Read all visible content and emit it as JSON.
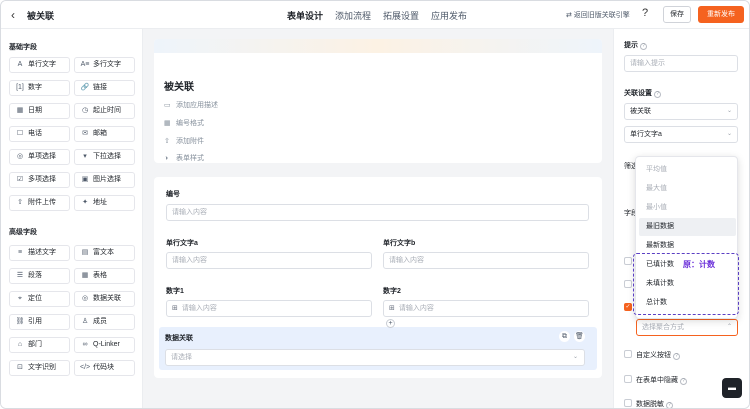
{
  "header": {
    "back_icon": "chevron-left-icon",
    "title": "被关联",
    "tabs": [
      "表单设计",
      "添加流程",
      "拓展设置",
      "应用发布"
    ],
    "active_tab": "表单设计",
    "swap_link": "⇄ 返回旧版关联引擎",
    "help_icon": "question-icon",
    "save_label": "保存",
    "publish_label": "重新发布",
    "accent_color": "#f5621f"
  },
  "left": {
    "basic_title": "基础字段",
    "basic_fields": [
      {
        "icon": "A",
        "label": "单行文字"
      },
      {
        "icon": "A≡",
        "label": "多行文字"
      },
      {
        "icon": "[1]",
        "label": "数字"
      },
      {
        "icon": "🔗",
        "label": "链接"
      },
      {
        "icon": "▦",
        "label": "日期"
      },
      {
        "icon": "◷",
        "label": "起止时间"
      },
      {
        "icon": "☐",
        "label": "电话"
      },
      {
        "icon": "✉",
        "label": "邮箱"
      },
      {
        "icon": "◎",
        "label": "单项选择"
      },
      {
        "icon": "▾",
        "label": "下拉选择"
      },
      {
        "icon": "☑",
        "label": "多项选择"
      },
      {
        "icon": "▣",
        "label": "图片选择"
      },
      {
        "icon": "⇧",
        "label": "附件上传"
      },
      {
        "icon": "✦",
        "label": "地址"
      }
    ],
    "advanced_title": "高级字段",
    "advanced_fields": [
      {
        "icon": "≡",
        "label": "描述文字"
      },
      {
        "icon": "▤",
        "label": "富文本"
      },
      {
        "icon": "☰",
        "label": "段落"
      },
      {
        "icon": "▦",
        "label": "表格"
      },
      {
        "icon": "⌖",
        "label": "定位"
      },
      {
        "icon": "◎",
        "label": "数据关联"
      },
      {
        "icon": "⛓",
        "label": "引用"
      },
      {
        "icon": "♙",
        "label": "成员"
      },
      {
        "icon": "⌂",
        "label": "部门"
      },
      {
        "icon": "∞",
        "label": "Q-Linker"
      },
      {
        "icon": "⊡",
        "label": "文字识别"
      },
      {
        "icon": "</>",
        "label": "代码块"
      }
    ]
  },
  "canvas": {
    "form_title": "被关联",
    "meta": [
      {
        "icon": "▭",
        "label": "添加应用描述"
      },
      {
        "icon": "▦",
        "label": "编号格式"
      },
      {
        "icon": "⇧",
        "label": "添加附件"
      },
      {
        "icon": "◑",
        "label": "表单样式"
      }
    ],
    "fields": {
      "number_label": "编号",
      "number_placeholder": "请输入内容",
      "text_a_label": "单行文字a",
      "text_a_placeholder": "请输入内容",
      "text_b_label": "单行文字b",
      "text_b_placeholder": "请输入内容",
      "num1_label": "数字1",
      "num1_placeholder": "请输入内容",
      "num2_label": "数字2",
      "num2_placeholder": "请输入内容",
      "relation_label": "数据关联",
      "relation_placeholder": "请选择"
    }
  },
  "right": {
    "hint_label": "提示",
    "hint_placeholder": "请输入提示",
    "relation_settings_label": "关联设置",
    "relation_form_value": "被关联",
    "relation_field_value": "单行文字a",
    "filter_peek": "筛选",
    "field_peek": "字段",
    "aggregate_placeholder": "选择聚合方式",
    "custom_button_label": "自定义按钮",
    "hide_in_form_label": "在表单中隐藏",
    "data_mask_label": "数据脱敏"
  },
  "dropdown": {
    "options": [
      {
        "label": "平均值",
        "state": "disabled"
      },
      {
        "label": "最大值",
        "state": "disabled"
      },
      {
        "label": "最小值",
        "state": "disabled"
      },
      {
        "label": "最旧数据",
        "state": "hover"
      },
      {
        "label": "最新数据",
        "state": "normal"
      },
      {
        "label": "已填计数",
        "state": "normal"
      },
      {
        "label": "未填计数",
        "state": "normal"
      },
      {
        "label": "总计数",
        "state": "normal"
      }
    ],
    "annotation": "原：计数"
  }
}
